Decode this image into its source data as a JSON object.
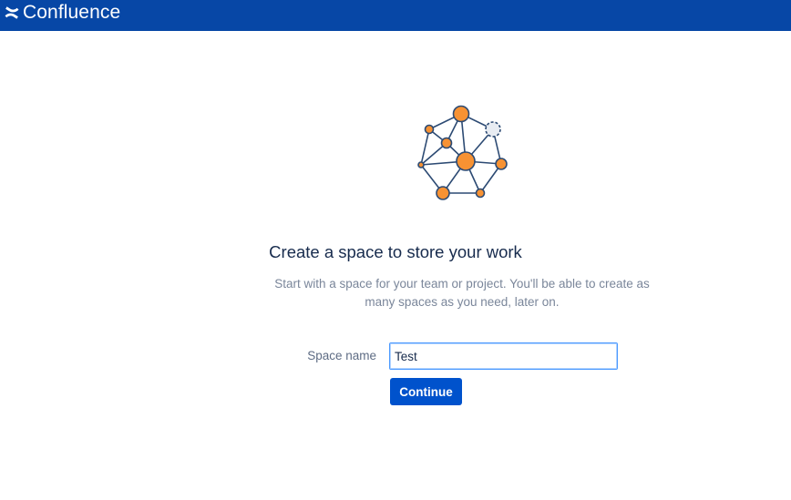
{
  "header": {
    "app_name": "Confluence",
    "logo_icon": "confluence-logo-icon",
    "background_color": "#0747a6"
  },
  "main": {
    "illustration_icon": "network-nodes-illustration",
    "title": "Create a space to store your work",
    "description": "Start with a space for your team or project. You'll be able to create as many spaces as you need, later on.",
    "space_name_label": "Space name",
    "space_name_value": "Test",
    "continue_label": "Continue"
  },
  "colors": {
    "primary": "#0052cc",
    "header": "#0747a6",
    "node_orange": "#f79233",
    "node_stroke": "#2c4a73",
    "input_focus": "#4c9aff"
  }
}
